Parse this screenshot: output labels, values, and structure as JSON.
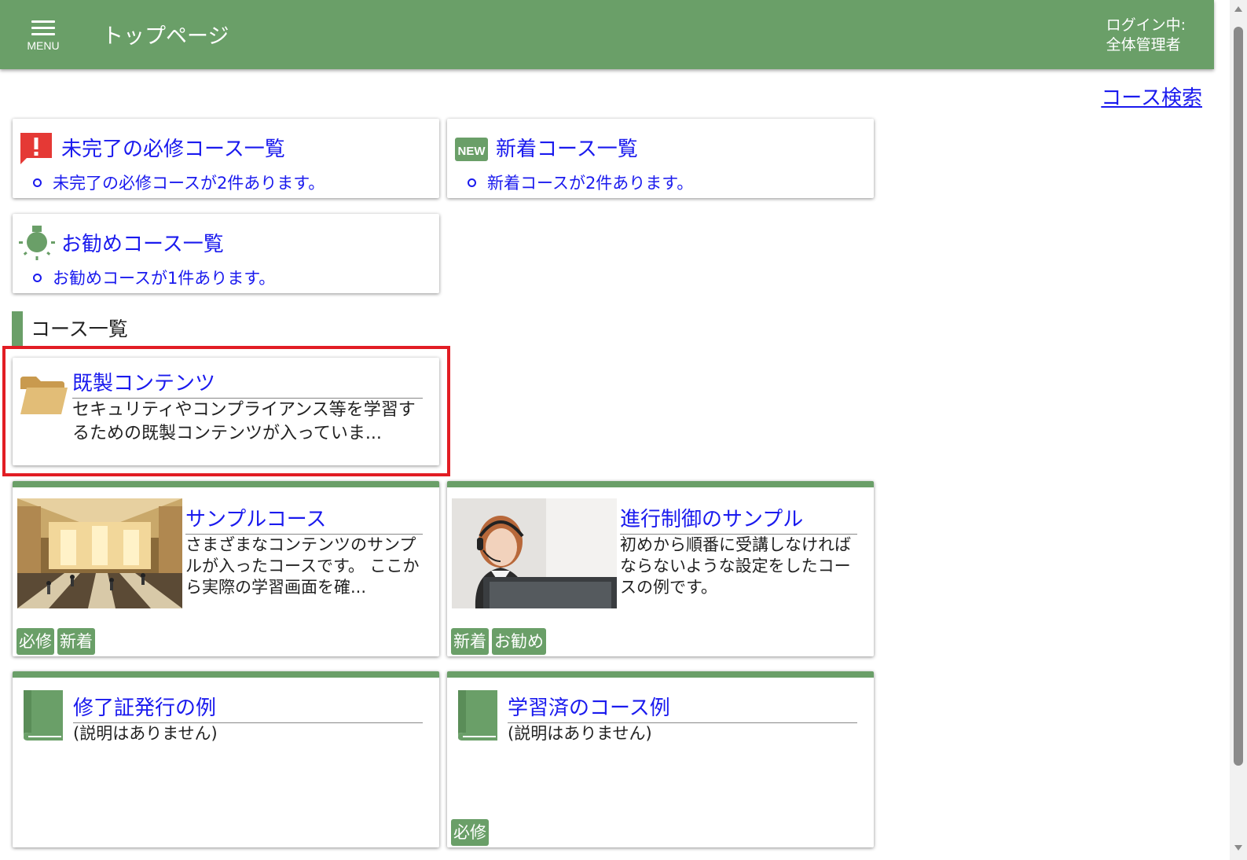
{
  "header": {
    "menu_label": "MENU",
    "title": "トップページ",
    "login_line1": "ログイン中:",
    "login_line2": "全体管理者"
  },
  "course_search_link": "コース検索",
  "info_cards": {
    "incomplete": {
      "title": "未完了の必修コース一覧",
      "item": "未完了の必修コースが2件あります。",
      "icon": "alert-icon"
    },
    "new": {
      "title": "新着コース一覧",
      "item": "新着コースが2件あります。",
      "icon": "new-icon"
    },
    "recommended": {
      "title": "お勧めコース一覧",
      "item": "お勧めコースが1件あります。",
      "icon": "lightbulb-icon"
    }
  },
  "section_title": "コース一覧",
  "courses": {
    "folder": {
      "title": "既製コンテンツ",
      "description": "セキュリティやコンプライアンス等を学習するための既製コンテンツが入っていま...",
      "icon": "folder-icon"
    },
    "sample": {
      "title": "サンプルコース",
      "description": "さまざまなコンテンツのサンプルが入ったコースです。 ここから実際の学習画面を確...",
      "badges": [
        "必修",
        "新着"
      ]
    },
    "progress": {
      "title": "進行制御のサンプル",
      "description": "初めから順番に受講しなければならないような設定をしたコースの例です。",
      "badges": [
        "新着",
        "お勧め"
      ]
    },
    "certificate": {
      "title": "修了証発行の例",
      "description": "(説明はありません)",
      "badges": [],
      "icon": "book-icon"
    },
    "completed": {
      "title": "学習済のコース例",
      "description": "(説明はありません)",
      "badges": [
        "必修"
      ],
      "icon": "book-icon"
    }
  },
  "colors": {
    "header": "#6a9f68",
    "link": "#1a1aee",
    "highlight": "#e21d24",
    "alert": "#e53935",
    "folder": "#e2bd77"
  }
}
